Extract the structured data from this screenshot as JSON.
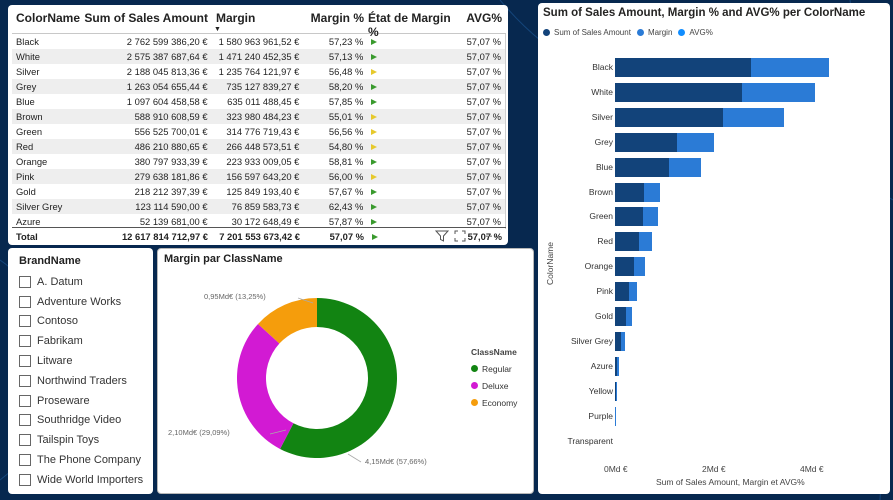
{
  "colors": {
    "dark_blue": "#12437a",
    "light_blue": "#2b7bd6",
    "regular": "#128412",
    "deluxe": "#d21ad3",
    "economy": "#f59d0c",
    "tri_green": "#3a9a2e",
    "tri_yellow": "#e6c92c"
  },
  "table": {
    "headers": [
      "ColorName",
      "Sum of Sales Amount",
      "Margin",
      "Margin %",
      "État de Margin %",
      "AVG%"
    ],
    "sort_indicator": "▼",
    "rows": [
      {
        "color": "Black",
        "sales": "2 762 599 386,20 €",
        "margin": "1 580 963 961,52 €",
        "margin_pct": "57,23 %",
        "etat": "green",
        "avg": "57,07 %"
      },
      {
        "color": "White",
        "sales": "2 575 387 687,64 €",
        "margin": "1 471 240 452,35 €",
        "margin_pct": "57,13 %",
        "etat": "green",
        "avg": "57,07 %"
      },
      {
        "color": "Silver",
        "sales": "2 188 045 813,36 €",
        "margin": "1 235 764 121,97 €",
        "margin_pct": "56,48 %",
        "etat": "yellow",
        "avg": "57,07 %"
      },
      {
        "color": "Grey",
        "sales": "1 263 054 655,44 €",
        "margin": "735 127 839,27 €",
        "margin_pct": "58,20 %",
        "etat": "green",
        "avg": "57,07 %"
      },
      {
        "color": "Blue",
        "sales": "1 097 604 458,58 €",
        "margin": "635 011 488,45 €",
        "margin_pct": "57,85 %",
        "etat": "green",
        "avg": "57,07 %"
      },
      {
        "color": "Brown",
        "sales": "588 910 608,59 €",
        "margin": "323 980 484,23 €",
        "margin_pct": "55,01 %",
        "etat": "yellow",
        "avg": "57,07 %"
      },
      {
        "color": "Green",
        "sales": "556 525 700,01 €",
        "margin": "314 776 719,43 €",
        "margin_pct": "56,56 %",
        "etat": "yellow",
        "avg": "57,07 %"
      },
      {
        "color": "Red",
        "sales": "486 210 880,65 €",
        "margin": "266 448 573,51 €",
        "margin_pct": "54,80 %",
        "etat": "yellow",
        "avg": "57,07 %"
      },
      {
        "color": "Orange",
        "sales": "380 797 933,39 €",
        "margin": "223 933 009,05 €",
        "margin_pct": "58,81 %",
        "etat": "green",
        "avg": "57,07 %"
      },
      {
        "color": "Pink",
        "sales": "279 638 181,86 €",
        "margin": "156 597 643,20 €",
        "margin_pct": "56,00 %",
        "etat": "yellow",
        "avg": "57,07 %"
      },
      {
        "color": "Gold",
        "sales": "218 212 397,39 €",
        "margin": "125 849 193,40 €",
        "margin_pct": "57,67 %",
        "etat": "green",
        "avg": "57,07 %"
      },
      {
        "color": "Silver Grey",
        "sales": "123 114 590,00 €",
        "margin": "76 859 583,73 €",
        "margin_pct": "62,43 %",
        "etat": "green",
        "avg": "57,07 %"
      },
      {
        "color": "Azure",
        "sales": "52 139 681,00 €",
        "margin": "30 172 648,49 €",
        "margin_pct": "57,87 %",
        "etat": "green",
        "avg": "57,07 %"
      }
    ],
    "total": {
      "label": "Total",
      "sales": "12 617 814 712,97 €",
      "margin": "7 201 553 673,42 €",
      "margin_pct": "57,07 %",
      "etat": "green",
      "avg": "57,07 %"
    },
    "icons": [
      "filter-icon",
      "focus-mode-icon",
      "more-options-icon"
    ]
  },
  "brand_slicer": {
    "title": "BrandName",
    "items": [
      "A. Datum",
      "Adventure Works",
      "Contoso",
      "Fabrikam",
      "Litware",
      "Northwind Traders",
      "Proseware",
      "Southridge Video",
      "Tailspin Toys",
      "The Phone Company",
      "Wide World Importers"
    ]
  },
  "donut": {
    "title": "Margin par ClassName",
    "legend_title": "ClassName",
    "labels": {
      "regular": "4,15Md€ (57,66%)",
      "deluxe": "2,10Md€ (29,09%)",
      "economy": "0,95Md€ (13,25%)"
    },
    "chart_data": {
      "type": "pie",
      "categories": [
        "Regular",
        "Deluxe",
        "Economy"
      ],
      "values": [
        4.15,
        2.1,
        0.95
      ],
      "percent": [
        57.66,
        29.09,
        13.25
      ],
      "title": "Margin par ClassName"
    }
  },
  "bars": {
    "title": "Sum of Sales Amount, Margin % and AVG% per ColorName",
    "legend": [
      "Sum of Sales Amount",
      "Margin",
      "AVG%"
    ],
    "y_axis_title": "ColorName",
    "x_axis_title": "Sum of Sales Amount, Margin et AVG%",
    "x_ticks": [
      "0Md €",
      "2Md €",
      "4Md €"
    ],
    "chart_data": {
      "type": "bar",
      "orientation": "horizontal",
      "stacked": true,
      "categories": [
        "Black",
        "White",
        "Silver",
        "Grey",
        "Blue",
        "Brown",
        "Green",
        "Red",
        "Orange",
        "Pink",
        "Gold",
        "Silver Grey",
        "Azure",
        "Yellow",
        "Purple",
        "Transparent"
      ],
      "series": [
        {
          "name": "Sum of Sales Amount",
          "values": [
            2.76,
            2.58,
            2.19,
            1.26,
            1.1,
            0.59,
            0.56,
            0.49,
            0.38,
            0.28,
            0.22,
            0.12,
            0.05,
            0.03,
            0.01,
            0.0
          ]
        },
        {
          "name": "Margin",
          "values": [
            1.58,
            1.47,
            1.24,
            0.74,
            0.64,
            0.32,
            0.31,
            0.27,
            0.22,
            0.16,
            0.13,
            0.08,
            0.03,
            0.02,
            0.01,
            0.0
          ]
        }
      ],
      "xlim": [
        0,
        4.4
      ],
      "xlabel": "Sum of Sales Amount, Margin et AVG%",
      "ylabel": "ColorName"
    }
  }
}
